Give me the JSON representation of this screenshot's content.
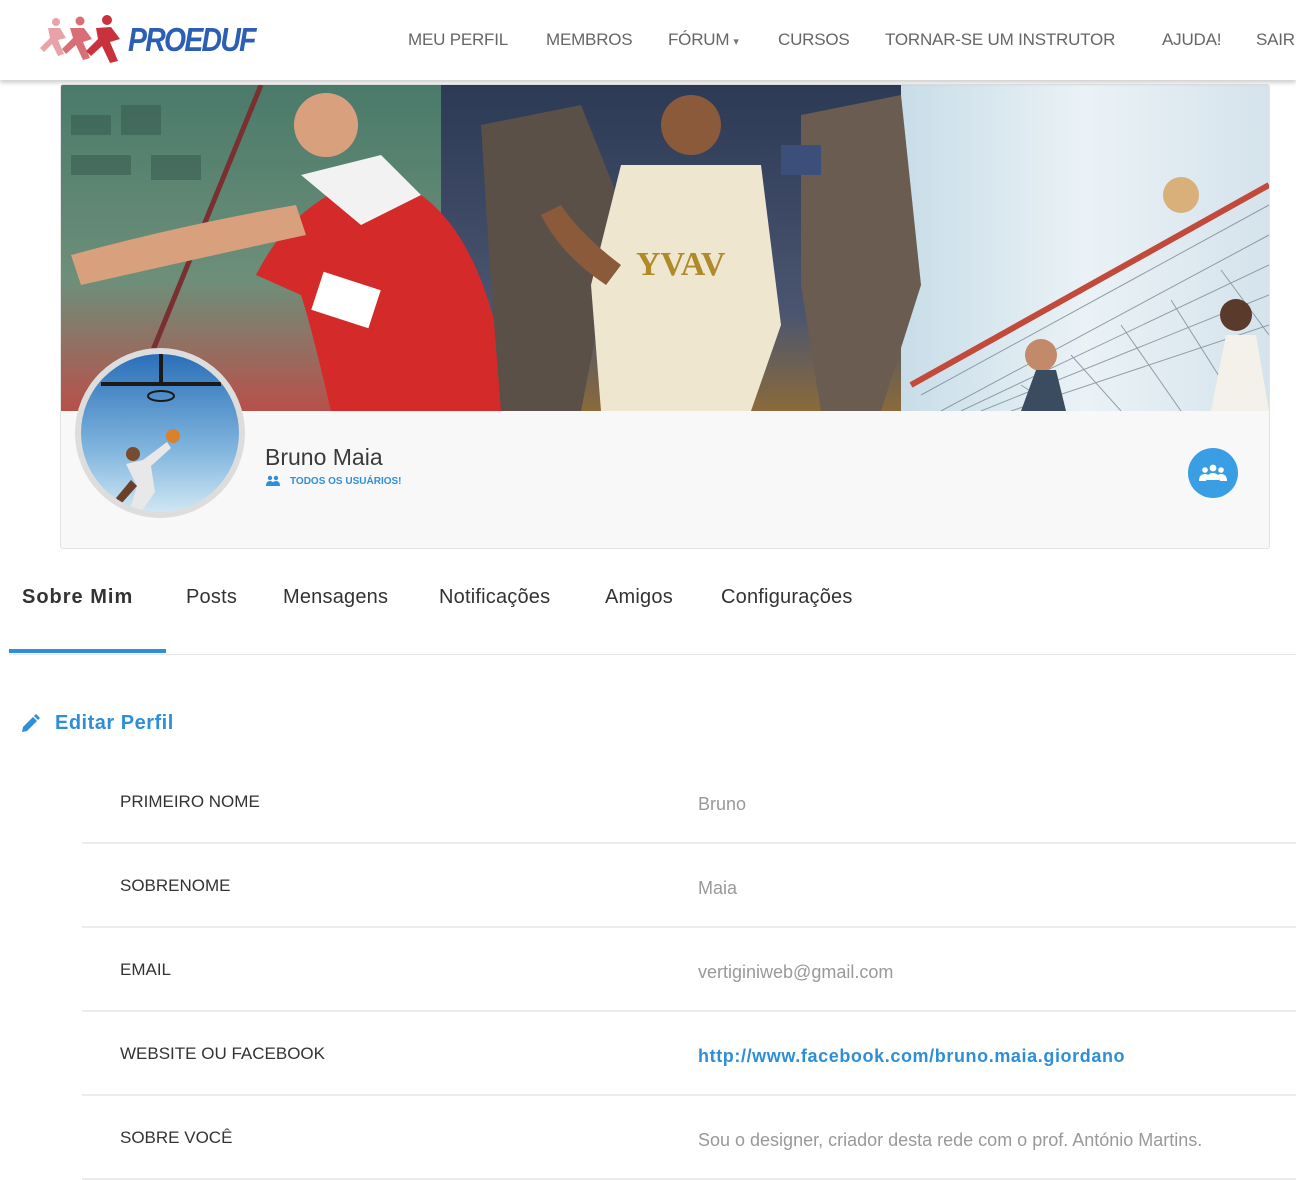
{
  "brand": {
    "logo_text": "PROEDUF"
  },
  "nav": {
    "items": [
      "MEU PERFIL",
      "MEMBROS",
      "FÓRUM",
      "CURSOS",
      "TORNAR-SE UM INSTRUTOR",
      "AJUDA!",
      "SAIR"
    ],
    "forum_caret": "▾"
  },
  "profile": {
    "name": "Bruno Maia",
    "role": "TODOS OS USUÁRIOS!"
  },
  "tabs": [
    "Sobre Mim",
    "Posts",
    "Mensagens",
    "Notificações",
    "Amigos",
    "Configurações"
  ],
  "active_tab": "Sobre Mim",
  "edit_profile": {
    "label": "Editar Perfil"
  },
  "fields": [
    {
      "label": "PRIMEIRO NOME",
      "value": "Bruno"
    },
    {
      "label": "SOBRENOME",
      "value": "Maia"
    },
    {
      "label": "EMAIL",
      "value": "vertiginiweb@gmail.com"
    },
    {
      "label": "WEBSITE OU FACEBOOK",
      "value": "http://www.facebook.com/bruno.maia.giordano"
    },
    {
      "label": "SOBRE VOCÊ",
      "value": "Sou o designer, criador desta rede com o prof. António Martins."
    }
  ],
  "colors": {
    "accent": "#2e8fd8",
    "logo": "#2a5fb4",
    "runners": "#c9323c"
  }
}
